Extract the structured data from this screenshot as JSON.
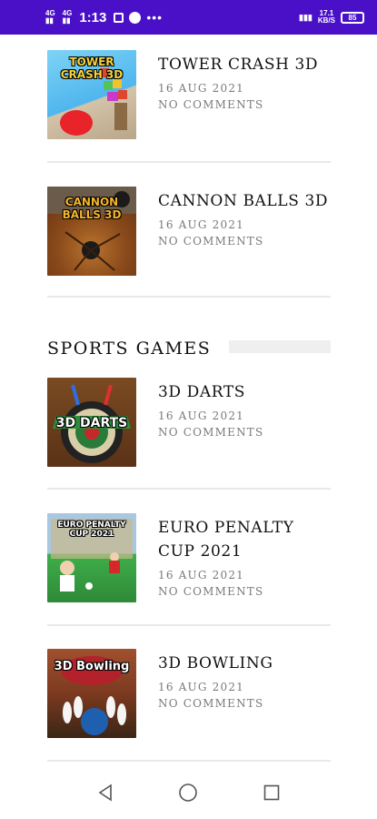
{
  "status_bar": {
    "signal1": "4G",
    "signal2": "4G",
    "time": "1:13",
    "speed_value": "17.1",
    "speed_unit": "KB/S",
    "battery": "85",
    "background": "#4a10c8"
  },
  "section": {
    "title": "SPORTS GAMES"
  },
  "posts": [
    {
      "title": "TOWER CRASH 3D",
      "date": "16 AUG 2021",
      "comments": "NO COMMENTS",
      "thumb_text": "TOWER CRASH 3D",
      "thumb_icon": "tower-crash-thumbnail"
    },
    {
      "title": "CANNON BALLS 3D",
      "date": "16 AUG 2021",
      "comments": "NO COMMENTS",
      "thumb_text": "CANNON BALLS 3D",
      "thumb_icon": "cannon-balls-thumbnail"
    },
    {
      "title": "3D DARTS",
      "date": "16 AUG 2021",
      "comments": "NO COMMENTS",
      "thumb_text": "3D DARTS",
      "thumb_icon": "darts-thumbnail"
    },
    {
      "title": "EURO PENALTY CUP 2021",
      "date": "16 AUG 2021",
      "comments": "NO COMMENTS",
      "thumb_text": "EURO PENALTY CUP 2021",
      "thumb_icon": "penalty-cup-thumbnail"
    },
    {
      "title": "3D BOWLING",
      "date": "16 AUG 2021",
      "comments": "NO COMMENTS",
      "thumb_text": "3D Bowling",
      "thumb_icon": "bowling-thumbnail"
    }
  ],
  "nav": {
    "back_icon": "back-triangle-icon",
    "home_icon": "home-circle-icon",
    "recents_icon": "recents-square-icon"
  }
}
